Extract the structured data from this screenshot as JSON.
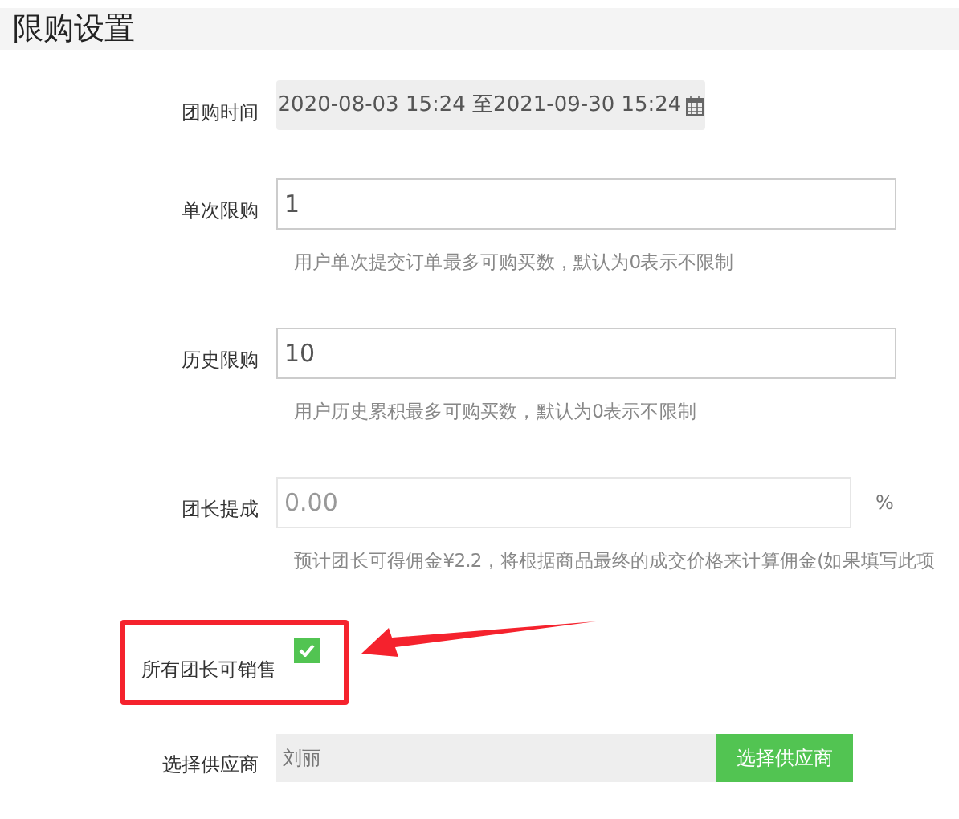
{
  "section_title": "限购设置",
  "date_range": {
    "label": "团购时间",
    "value": "2020-08-03 15:24 至2021-09-30 15:24"
  },
  "fields": [
    {
      "label": "单次限购",
      "value": "1",
      "hint": "用户单次提交订单最多可购买数，默认为0表示不限制"
    },
    {
      "label": "历史限购",
      "value": "10",
      "hint": "用户历史累积最多可购买数，默认为0表示不限制"
    },
    {
      "label": "团长提成",
      "placeholder": "0.00",
      "unit": "%",
      "hint": "预计团长可得佣金¥2.2，将根据商品最终的成交价格来计算佣金(如果填写此项"
    }
  ],
  "all_leaders_can_sell": {
    "label": "所有团长可销售",
    "checked": true
  },
  "supplier": {
    "label": "选择供应商",
    "value": "刘丽",
    "button": "选择供应商"
  }
}
